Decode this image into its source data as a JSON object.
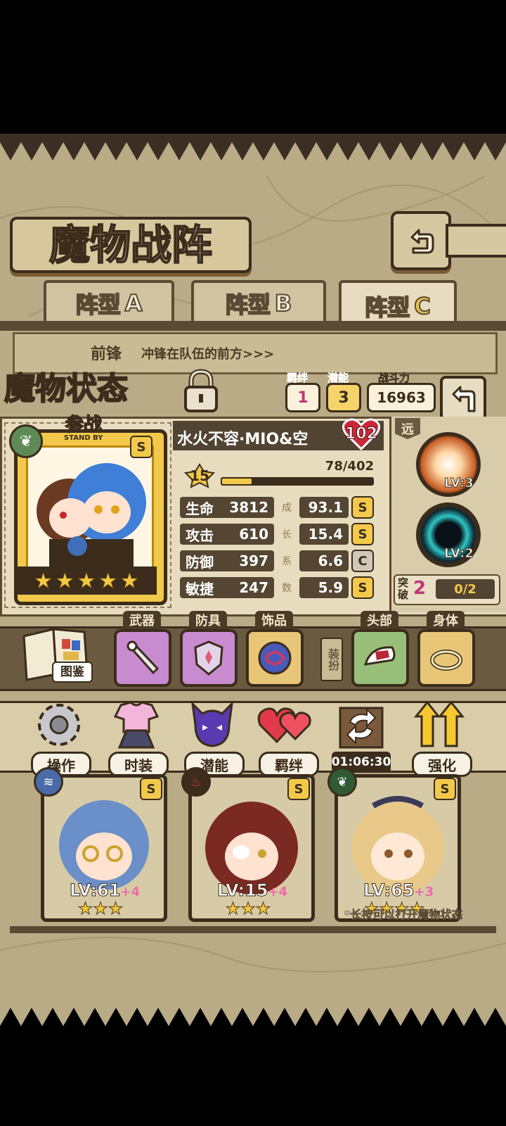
{
  "screen_title": "魔物战阵",
  "formation_tabs": [
    {
      "label": "阵型",
      "suffix": "A"
    },
    {
      "label": "阵型",
      "suffix": "B"
    },
    {
      "label": "阵型",
      "suffix": "C"
    }
  ],
  "position": {
    "label": "前锋",
    "desc": "冲锋在队伍的前方>>>"
  },
  "status_panel": {
    "title": "魔物状态",
    "bond_label": "羁绊",
    "bond_value": "1",
    "potential_label": "潜能",
    "potential_value": "3",
    "power_label": "战斗力",
    "power_value": "16963"
  },
  "monster": {
    "standby_label": "参战",
    "standby_sub": "STAND BY",
    "grade": "S",
    "name": "水火不容·MIO&空",
    "heart_value": "102",
    "level": "15",
    "exp_text": "78/402",
    "exp_fraction": 0.194,
    "stars": "★★★★★",
    "stats": [
      {
        "label": "生命",
        "value": "3812",
        "growth": "93.1",
        "grade": "S"
      },
      {
        "label": "攻击",
        "value": "610",
        "growth": "15.4",
        "grade": "S"
      },
      {
        "label": "防御",
        "value": "397",
        "growth": "6.6",
        "grade": "C"
      },
      {
        "label": "敏捷",
        "value": "247",
        "growth": "5.9",
        "grade": "S"
      }
    ],
    "growth_vertical": [
      "成",
      "长",
      "系",
      "数"
    ]
  },
  "skills": {
    "range_label": "远",
    "items": [
      {
        "level": "LV:3"
      },
      {
        "level": "LV:2"
      }
    ],
    "break_label": "突破",
    "break_value": "2",
    "break_progress": "0/2"
  },
  "equipment": {
    "book_label": "图鉴",
    "slots": [
      {
        "label": "武器",
        "icon": "weapon-icon"
      },
      {
        "label": "防具",
        "icon": "armor-icon"
      },
      {
        "label": "饰品",
        "icon": "accessory-icon"
      }
    ],
    "outfit_label": "装扮",
    "outfit_slots": [
      {
        "label": "头部",
        "icon": "headwear-icon"
      },
      {
        "label": "身体",
        "icon": "body-icon"
      }
    ]
  },
  "menu": [
    {
      "label": "操作",
      "icon": "gear-icon"
    },
    {
      "label": "时装",
      "icon": "outfit-icon"
    },
    {
      "label": "潜能",
      "icon": "potential-icon"
    },
    {
      "label": "羁绊",
      "icon": "bond-icon"
    },
    {
      "label": "01:06:30",
      "icon": "swap-icon"
    },
    {
      "label": "强化",
      "icon": "upgrade-icon"
    }
  ],
  "roster": [
    {
      "level": "LV:61",
      "bonus": "+4",
      "grade": "S",
      "stars": "★★★"
    },
    {
      "level": "LV:15",
      "bonus": "+4",
      "grade": "S",
      "stars": "★★★"
    },
    {
      "level": "LV:65",
      "bonus": "+3",
      "grade": "S",
      "stars": "★★★★"
    }
  ],
  "hint": "*长按可以打开魔物状态",
  "colors": {
    "accent_gold": "#f2c940",
    "bond_pink": "#c0357a",
    "potential_gold": "#c79a24",
    "panel_beige": "#e8dcbf",
    "dark_brown": "#3b2c1c"
  }
}
